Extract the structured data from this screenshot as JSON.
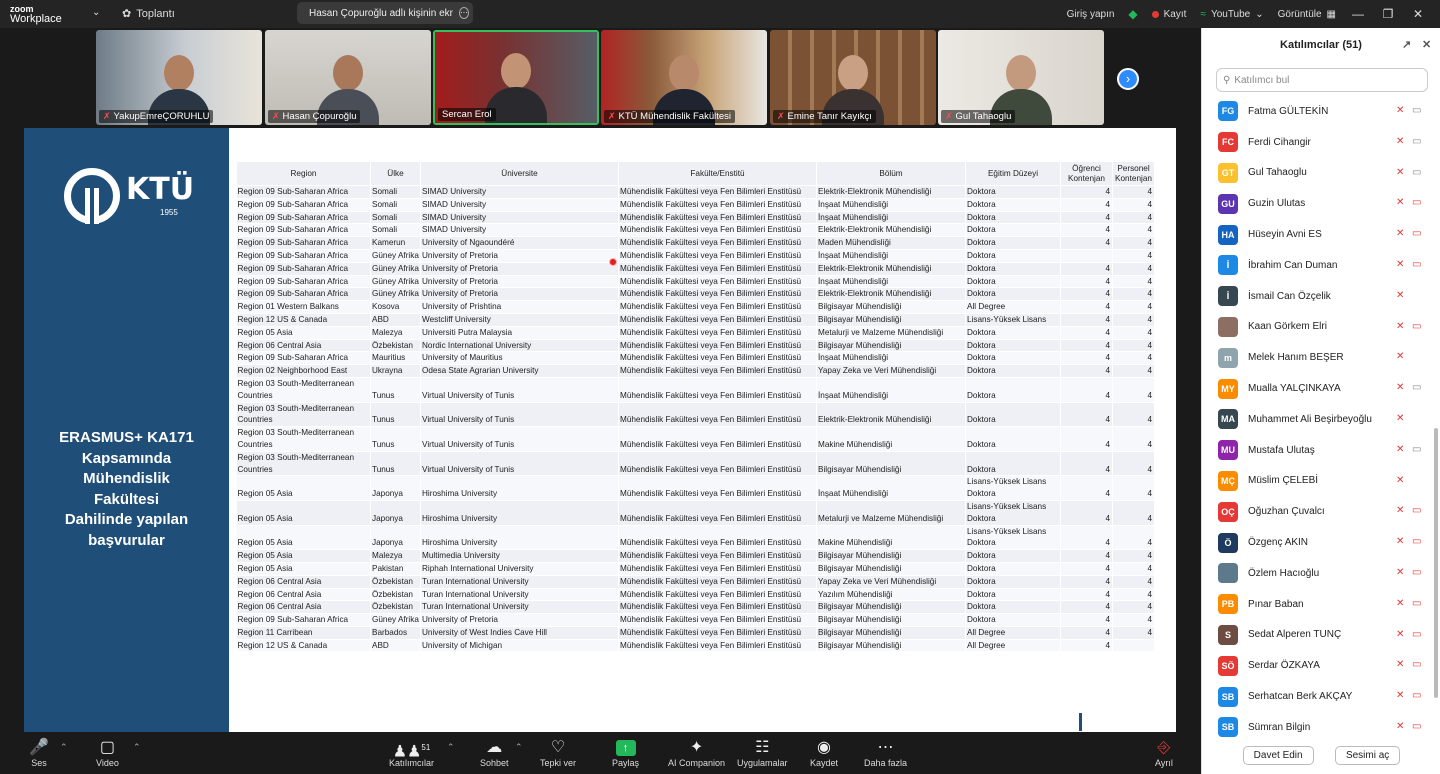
{
  "topbar": {
    "logo_line1": "zoom",
    "logo_line2": "Workplace",
    "meeting_label": "Toplantı",
    "share_notice": "Hasan Çopuroğlu adlı kişinin ekr",
    "signin": "Giriş yapın",
    "record": "Kayıt",
    "youtube": "YouTube",
    "view": "Görüntüle"
  },
  "videos": [
    {
      "name": "YakupEmreÇORUHLU"
    },
    {
      "name": "Hasan Çopuroğlu"
    },
    {
      "name": "Sercan Erol"
    },
    {
      "name": "KTÜ Mühendislik Fakültesi"
    },
    {
      "name": "Emine Tanır Kayıkçı"
    },
    {
      "name": "Gul Tahaoglu"
    }
  ],
  "slide": {
    "ktu": "KTÜ",
    "year": "1955",
    "title_lines": [
      "ERASMUS+ KA171",
      "Kapsamında",
      "Mühendislik",
      "Fakültesi",
      "Dahilinde yapılan",
      "başvurular"
    ]
  },
  "table": {
    "headers": [
      "Region",
      "Ülke",
      "Üniversite",
      "Fakülte/Enstitü",
      "Bölüm",
      "Eğitim Düzeyi",
      "Öğrenci Kontenjan",
      "Personel Kontenjan"
    ],
    "rows": [
      [
        "Region 09 Sub-Saharan Africa",
        "Somali",
        "SIMAD University",
        "Mühendislik Fakültesi veya Fen Bilimleri Enstitüsü",
        "Elektrik-Elektronik Mühendisliği",
        "Doktora",
        "4",
        "4"
      ],
      [
        "Region 09 Sub-Saharan Africa",
        "Somali",
        "SIMAD University",
        "Mühendislik Fakültesi veya Fen Bilimleri Enstitüsü",
        "İnşaat Mühendisliği",
        "Doktora",
        "4",
        "4"
      ],
      [
        "Region 09 Sub-Saharan Africa",
        "Somali",
        "SIMAD University",
        "Mühendislik Fakültesi veya Fen Bilimleri Enstitüsü",
        "İnşaat Mühendisliği",
        "Doktora",
        "4",
        "4"
      ],
      [
        "Region 09 Sub-Saharan Africa",
        "Somali",
        "SIMAD University",
        "Mühendislik Fakültesi veya Fen Bilimleri Enstitüsü",
        "Elektrik-Elektronik Mühendisliği",
        "Doktora",
        "4",
        "4"
      ],
      [
        "Region 09 Sub-Saharan Africa",
        "Kamerun",
        "University of Ngaoundéré",
        "Mühendislik Fakültesi veya Fen Bilimleri Enstitüsü",
        "Maden Mühendisliği",
        "Doktora",
        "4",
        "4"
      ],
      [
        "Region 09 Sub-Saharan Africa",
        "Güney Afrika",
        "University of Pretoria",
        "Mühendislik Fakültesi veya Fen Bilimleri Enstitüsü",
        "İnşaat Mühendisliği",
        "Doktora",
        "",
        "4"
      ],
      [
        "Region 09 Sub-Saharan Africa",
        "Güney Afrika",
        "University of Pretoria",
        "Mühendislik Fakültesi veya Fen Bilimleri Enstitüsü",
        "Elektrik-Elektronik Mühendisliği",
        "Doktora",
        "4",
        "4"
      ],
      [
        "Region 09 Sub-Saharan Africa",
        "Güney Afrika",
        "University of Pretoria",
        "Mühendislik Fakültesi veya Fen Bilimleri Enstitüsü",
        "İnşaat Mühendisliği",
        "Doktora",
        "4",
        "4"
      ],
      [
        "Region 09 Sub-Saharan Africa",
        "Güney Afrika",
        "University of Pretoria",
        "Mühendislik Fakültesi veya Fen Bilimleri Enstitüsü",
        "Elektrik-Elektronik Mühendisliği",
        "Doktora",
        "4",
        "4"
      ],
      [
        "Region 01 Western Balkans",
        "Kosova",
        "University of Prishtina",
        "Mühendislik Fakültesi veya Fen Bilimleri Enstitüsü",
        "Bilgisayar Mühendisliği",
        "All Degree",
        "4",
        "4"
      ],
      [
        "Region 12 US & Canada",
        "ABD",
        "Westcliff University",
        "Mühendislik Fakültesi veya Fen Bilimleri Enstitüsü",
        "Bilgisayar Mühendisliği",
        "Lisans-Yüksek Lisans",
        "4",
        "4"
      ],
      [
        "Region 05 Asia",
        "Malezya",
        "Universiti Putra Malaysia",
        "Mühendislik Fakültesi veya Fen Bilimleri Enstitüsü",
        "Metalurji ve Malzeme Mühendisliği",
        "Doktora",
        "4",
        "4"
      ],
      [
        "Region 06 Central Asia",
        "Özbekistan",
        "Nordic International University",
        "Mühendislik Fakültesi veya Fen Bilimleri Enstitüsü",
        "Bilgisayar Mühendisliği",
        "Doktora",
        "4",
        "4"
      ],
      [
        "Region 09 Sub-Saharan Africa",
        "Mauritius",
        "University of Mauritius",
        "Mühendislik Fakültesi veya Fen Bilimleri Enstitüsü",
        "İnşaat Mühendisliği",
        "Doktora",
        "4",
        "4"
      ],
      [
        "Region 02 Neighborhood East",
        "Ukrayna",
        "Odesa State Agrarian University",
        "Mühendislik Fakültesi veya Fen Bilimleri Enstitüsü",
        "Yapay Zeka ve Veri Mühendisliği",
        "Doktora",
        "4",
        "4"
      ],
      [
        "Region 03 South-Mediterranean Countries",
        "Tunus",
        "Virtual University of Tunis",
        "Mühendislik Fakültesi veya Fen Bilimleri Enstitüsü",
        "İnşaat Mühendisliği",
        "Doktora",
        "4",
        "4"
      ],
      [
        "Region 03 South-Mediterranean Countries",
        "Tunus",
        "Virtual University of Tunis",
        "Mühendislik Fakültesi veya Fen Bilimleri Enstitüsü",
        "Elektrik-Elektronik Mühendisliği",
        "Doktora",
        "4",
        "4"
      ],
      [
        "Region 03 South-Mediterranean Countries",
        "Tunus",
        "Virtual University of Tunis",
        "Mühendislik Fakültesi veya Fen Bilimleri Enstitüsü",
        "Makine Mühendisliği",
        "Doktora",
        "4",
        "4"
      ],
      [
        "Region 03 South-Mediterranean Countries",
        "Tunus",
        "Virtual University of Tunis",
        "Mühendislik Fakültesi veya Fen Bilimleri Enstitüsü",
        "Bilgisayar Mühendisliği",
        "Doktora",
        "4",
        "4"
      ],
      [
        "Region 05 Asia",
        "Japonya",
        "Hiroshima University",
        "Mühendislik Fakültesi veya Fen Bilimleri Enstitüsü",
        "İnşaat Mühendisliği",
        "Lisans-Yüksek Lisans Doktora",
        "4",
        "4"
      ],
      [
        "Region 05 Asia",
        "Japonya",
        "Hiroshima University",
        "Mühendislik Fakültesi veya Fen Bilimleri Enstitüsü",
        "Metalurji ve Malzeme Mühendisliği",
        "Lisans-Yüksek Lisans Doktora",
        "4",
        "4"
      ],
      [
        "Region 05 Asia",
        "Japonya",
        "Hiroshima University",
        "Mühendislik Fakültesi veya Fen Bilimleri Enstitüsü",
        "Makine Mühendisliği",
        "Lisans-Yüksek Lisans Doktora",
        "4",
        "4"
      ],
      [
        "Region 05 Asia",
        "Malezya",
        "Multimedia University",
        "Mühendislik Fakültesi veya Fen Bilimleri Enstitüsü",
        "Bilgisayar Mühendisliği",
        "Doktora",
        "4",
        "4"
      ],
      [
        "Region 05 Asia",
        "Pakistan",
        "Riphah International University",
        "Mühendislik Fakültesi veya Fen Bilimleri Enstitüsü",
        "Bilgisayar Mühendisliği",
        "Doktora",
        "4",
        "4"
      ],
      [
        "Region 06 Central Asia",
        "Özbekistan",
        "Turan International University",
        "Mühendislik Fakültesi veya Fen Bilimleri Enstitüsü",
        "Yapay Zeka ve Veri Mühendisliği",
        "Doktora",
        "4",
        "4"
      ],
      [
        "Region 06 Central Asia",
        "Özbekistan",
        "Turan International University",
        "Mühendislik Fakültesi veya Fen Bilimleri Enstitüsü",
        "Yazılım Mühendisliği",
        "Doktora",
        "4",
        "4"
      ],
      [
        "Region 06 Central Asia",
        "Özbekistan",
        "Turan International University",
        "Mühendislik Fakültesi veya Fen Bilimleri Enstitüsü",
        "Bilgisayar Mühendisliği",
        "Doktora",
        "4",
        "4"
      ],
      [
        "Region 09 Sub-Saharan Africa",
        "Güney Afrika",
        "University of Pretoria",
        "Mühendislik Fakültesi veya Fen Bilimleri Enstitüsü",
        "Bilgisayar Mühendisliği",
        "Doktora",
        "4",
        "4"
      ],
      [
        "Region 11 Carribean",
        "Barbados",
        "University of West Indies Cave Hill",
        "Mühendislik Fakültesi veya Fen Bilimleri Enstitüsü",
        "Bilgisayar Mühendisliği",
        "All Degree",
        "4",
        "4"
      ],
      [
        "Region 12 US & Canada",
        "ABD",
        "University of Michigan",
        "Mühendislik Fakültesi veya Fen Bilimleri Enstitüsü",
        "Bilgisayar Mühendisliği",
        "All Degree",
        "4",
        ""
      ]
    ]
  },
  "participants": {
    "title": "Katılımcılar (51)",
    "search_placeholder": "Katılımcı bul",
    "invite": "Davet Edin",
    "unmute_all": "Sesimi aç",
    "list": [
      {
        "initials": "FG",
        "name": "Fatma GÜLTEKİN",
        "color": "#1e88e5",
        "cam": "on"
      },
      {
        "initials": "FC",
        "name": "Ferdi Cihangir",
        "color": "#e53935",
        "cam": "on"
      },
      {
        "initials": "GT",
        "name": "Gul Tahaoglu",
        "color": "#fbc02d",
        "cam": "on"
      },
      {
        "initials": "GU",
        "name": "Guzin Ulutas",
        "color": "#5e35b1",
        "cam": "off"
      },
      {
        "initials": "HA",
        "name": "Hüseyin Avni ES",
        "color": "#1565c0",
        "cam": "off"
      },
      {
        "initials": "İ",
        "name": "İbrahim Can Duman",
        "color": "#1e88e5",
        "cam": "off"
      },
      {
        "initials": "İ",
        "name": "İsmail Can Özçelik",
        "color": "#37474f",
        "cam": "none"
      },
      {
        "initials": "",
        "name": "Kaan Görkem Elri",
        "color": "#8d6e63",
        "cam": "off"
      },
      {
        "initials": "m",
        "name": "Melek Hanım BEŞER",
        "color": "#90a4ae",
        "cam": "none"
      },
      {
        "initials": "MY",
        "name": "Mualla YALÇINKAYA",
        "color": "#fb8c00",
        "cam": "on"
      },
      {
        "initials": "MA",
        "name": "Muhammet Ali Beşirbeyoğlu",
        "color": "#37474f",
        "cam": "none"
      },
      {
        "initials": "MU",
        "name": "Mustafa Ulutaş",
        "color": "#8e24aa",
        "cam": "on"
      },
      {
        "initials": "MÇ",
        "name": "Müslim ÇELEBİ",
        "color": "#fb8c00",
        "cam": "none"
      },
      {
        "initials": "OÇ",
        "name": "Oğuzhan Çuvalcı",
        "color": "#e53935",
        "cam": "off"
      },
      {
        "initials": "Ö",
        "name": "Özgenç AKIN",
        "color": "#1e3a5f",
        "cam": "off"
      },
      {
        "initials": "",
        "name": "Özlem Hacıoğlu",
        "color": "#5d7a8c",
        "cam": "off"
      },
      {
        "initials": "PB",
        "name": "Pınar Baban",
        "color": "#fb8c00",
        "cam": "off"
      },
      {
        "initials": "S",
        "name": "Sedat Alperen TUNÇ",
        "color": "#6d4c41",
        "cam": "off"
      },
      {
        "initials": "SÖ",
        "name": "Serdar ÖZKAYA",
        "color": "#e53935",
        "cam": "off"
      },
      {
        "initials": "SB",
        "name": "Serhatcan Berk AKÇAY",
        "color": "#1e88e5",
        "cam": "off"
      },
      {
        "initials": "SB",
        "name": "Sümran Bilgin",
        "color": "#1e88e5",
        "cam": "off"
      }
    ]
  },
  "toolbar": {
    "audio": "Ses",
    "video": "Video",
    "participants": "Katılımcılar",
    "participants_count": "51",
    "chat": "Sohbet",
    "react": "Tepki ver",
    "share": "Paylaş",
    "ai": "AI Companion",
    "apps": "Uygulamalar",
    "record": "Kaydet",
    "more": "Daha fazla",
    "leave": "Ayrıl"
  }
}
